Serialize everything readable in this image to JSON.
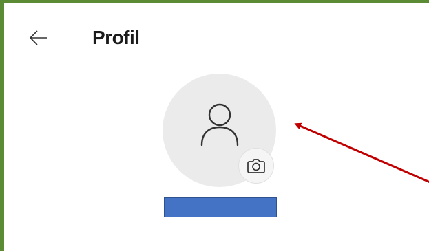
{
  "header": {
    "back_icon": "arrow-left-icon",
    "title": "Profil"
  },
  "avatar": {
    "icon": "person-icon",
    "camera_icon": "camera-icon"
  },
  "colors": {
    "frame_border": "#5b8c35",
    "avatar_bg": "#ebebeb",
    "redaction_fill": "#4472c4",
    "annotation_arrow": "#c00000"
  }
}
